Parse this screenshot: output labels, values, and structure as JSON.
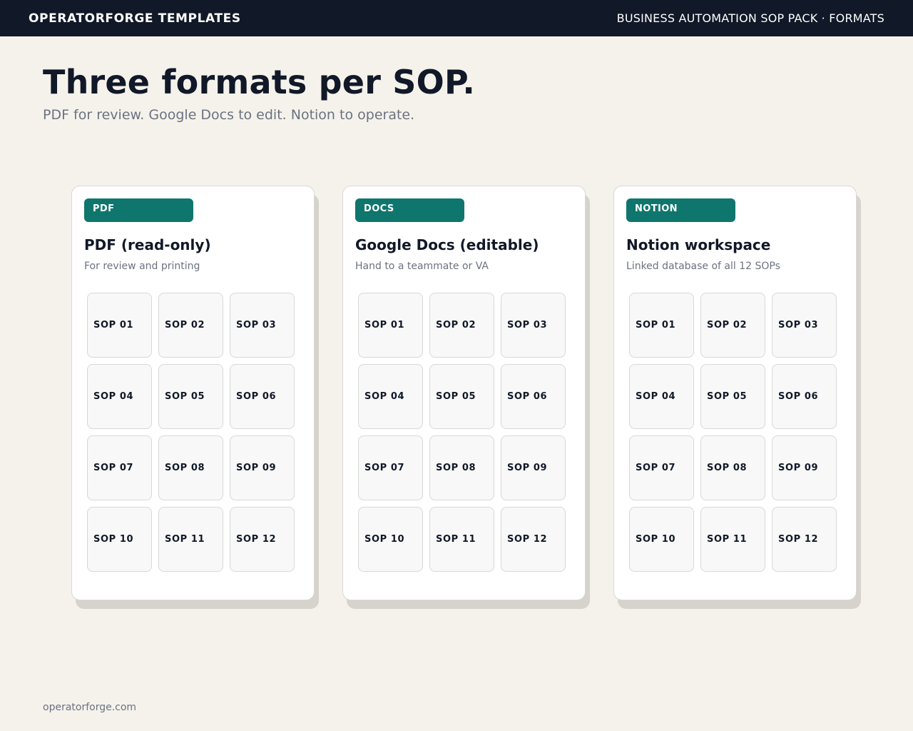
{
  "header": {
    "brand": "OPERATORFORGE TEMPLATES",
    "section": "BUSINESS AUTOMATION SOP PACK · FORMATS"
  },
  "hero": {
    "title": "Three formats per SOP.",
    "subtitle": "PDF for review. Google Docs to edit. Notion to operate."
  },
  "cards": [
    {
      "badge": "PDF",
      "title": "PDF (read-only)",
      "description": "For review and printing",
      "items": [
        "SOP 01",
        "SOP 02",
        "SOP 03",
        "SOP 04",
        "SOP 05",
        "SOP 06",
        "SOP 07",
        "SOP 08",
        "SOP 09",
        "SOP 10",
        "SOP 11",
        "SOP 12"
      ]
    },
    {
      "badge": "DOCS",
      "title": "Google Docs (editable)",
      "description": "Hand to a teammate or VA",
      "items": [
        "SOP 01",
        "SOP 02",
        "SOP 03",
        "SOP 04",
        "SOP 05",
        "SOP 06",
        "SOP 07",
        "SOP 08",
        "SOP 09",
        "SOP 10",
        "SOP 11",
        "SOP 12"
      ]
    },
    {
      "badge": "NOTION",
      "title": "Notion workspace",
      "description": "Linked database of all 12 SOPs",
      "items": [
        "SOP 01",
        "SOP 02",
        "SOP 03",
        "SOP 04",
        "SOP 05",
        "SOP 06",
        "SOP 07",
        "SOP 08",
        "SOP 09",
        "SOP 10",
        "SOP 11",
        "SOP 12"
      ]
    }
  ],
  "footer": {
    "url": "operatorforge.com"
  },
  "colors": {
    "background": "#f5f2ec",
    "topbar": "#111827",
    "badge": "#0f766e",
    "muted_text": "#6b7280"
  }
}
